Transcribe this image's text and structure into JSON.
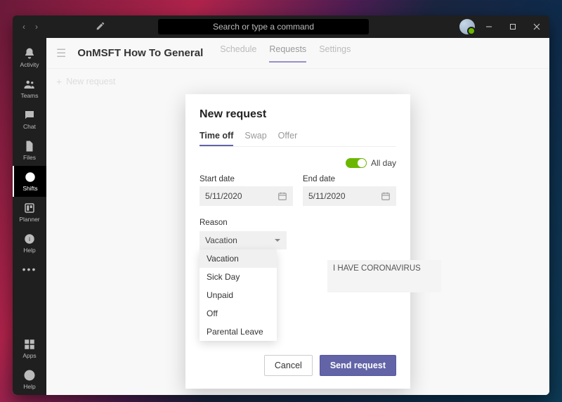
{
  "titlebar": {
    "search_placeholder": "Search or type a command"
  },
  "rail": {
    "items": [
      {
        "key": "activity",
        "label": "Activity"
      },
      {
        "key": "teams",
        "label": "Teams"
      },
      {
        "key": "chat",
        "label": "Chat"
      },
      {
        "key": "files",
        "label": "Files"
      },
      {
        "key": "shifts",
        "label": "Shifts"
      },
      {
        "key": "planner",
        "label": "Planner"
      },
      {
        "key": "help",
        "label": "Help"
      }
    ],
    "bottom": [
      {
        "key": "apps",
        "label": "Apps"
      },
      {
        "key": "help2",
        "label": "Help"
      }
    ]
  },
  "header": {
    "team_name": "OnMSFT How To General",
    "tabs": [
      {
        "key": "schedule",
        "label": "Schedule"
      },
      {
        "key": "requests",
        "label": "Requests"
      },
      {
        "key": "settings",
        "label": "Settings"
      }
    ],
    "new_request_label": "New request"
  },
  "modal": {
    "title": "New request",
    "tabs": [
      {
        "key": "timeoff",
        "label": "Time off"
      },
      {
        "key": "swap",
        "label": "Swap"
      },
      {
        "key": "offer",
        "label": "Offer"
      }
    ],
    "all_day_label": "All day",
    "all_day_value": true,
    "start_date_label": "Start date",
    "start_date_value": "5/11/2020",
    "end_date_label": "End date",
    "end_date_value": "5/11/2020",
    "reason_label": "Reason",
    "reason_selected": "Vacation",
    "reason_options": [
      "Vacation",
      "Sick Day",
      "Unpaid",
      "Off",
      "Parental Leave"
    ],
    "note_value": "I HAVE CORONAVIRUS",
    "cancel_label": "Cancel",
    "send_label": "Send request"
  },
  "colors": {
    "brand": "#6264a7",
    "success": "#6bb700"
  }
}
